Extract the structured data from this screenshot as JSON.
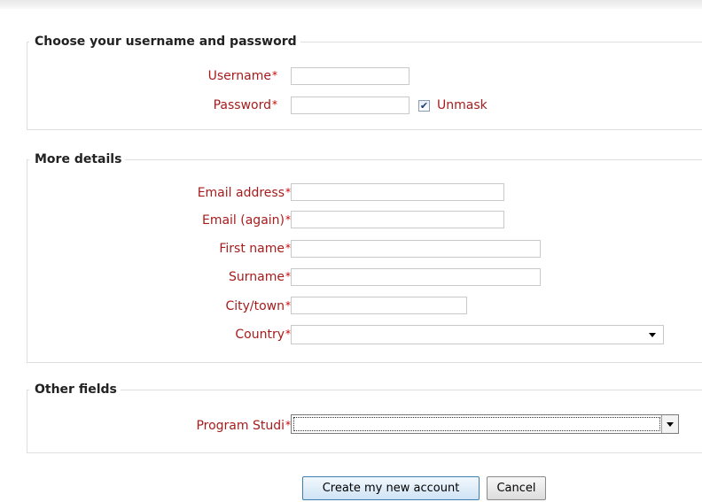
{
  "sections": {
    "credentials": {
      "legend": "Choose your username and password",
      "username_label": "Username",
      "password_label": "Password",
      "unmask_label": "Unmask",
      "unmask_checked": true,
      "required_mark": "*"
    },
    "details": {
      "legend": "More details",
      "email_label": "Email address",
      "email_again_label": "Email (again)",
      "first_name_label": "First name",
      "surname_label": "Surname",
      "city_label": "City/town",
      "country_label": "Country",
      "required_mark": "*"
    },
    "other": {
      "legend": "Other fields",
      "program_label": "Program Studi",
      "required_mark": "*"
    }
  },
  "buttons": {
    "create_label": "Create my new account",
    "cancel_label": "Cancel"
  },
  "colors": {
    "label_red": "#a61c1c",
    "primary_button": "#3c7fb1"
  }
}
